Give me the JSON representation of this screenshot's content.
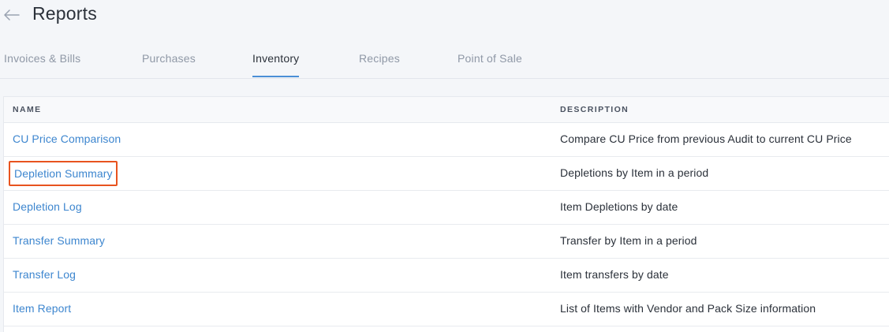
{
  "header": {
    "title": "Reports"
  },
  "tabs": [
    {
      "label": "Invoices & Bills"
    },
    {
      "label": "Purchases"
    },
    {
      "label": "Inventory",
      "active": true
    },
    {
      "label": "Recipes"
    },
    {
      "label": "Point of Sale"
    }
  ],
  "table": {
    "columns": {
      "name": "NAME",
      "description": "DESCRIPTION"
    },
    "rows": [
      {
        "name": "CU Price Comparison",
        "description": "Compare CU Price from previous Audit to current CU Price"
      },
      {
        "name": "Depletion Summary",
        "description": "Depletions by Item in a period",
        "highlighted": true
      },
      {
        "name": "Depletion Log",
        "description": "Item Depletions by date"
      },
      {
        "name": "Transfer Summary",
        "description": "Transfer by Item in a period"
      },
      {
        "name": "Transfer Log",
        "description": "Item transfers by date"
      },
      {
        "name": "Item Report",
        "description": "List of Items with Vendor and Pack Size information"
      }
    ]
  },
  "colors": {
    "accent": "#3d86cf",
    "tab_underline": "#4a8fd6",
    "highlight_border": "#e8531e"
  },
  "icons": {
    "back": "arrow-left-icon"
  }
}
